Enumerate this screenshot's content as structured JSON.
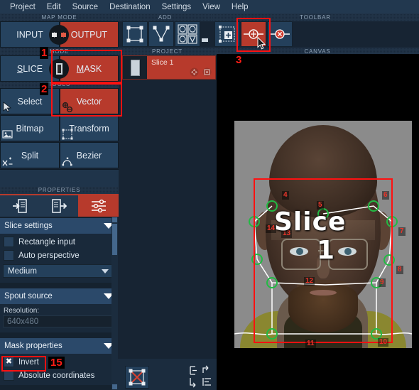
{
  "menubar": {
    "items": [
      {
        "label": "Project"
      },
      {
        "label": "Edit"
      },
      {
        "label": "Source"
      },
      {
        "label": "Destination"
      },
      {
        "label": "Settings"
      },
      {
        "label": "View"
      },
      {
        "label": "Help"
      }
    ]
  },
  "sections": {
    "map_mode": "MAP MODE",
    "add": "ADD",
    "toolbar": "TOOLBAR",
    "mode": "MODE",
    "project": "PROJECT",
    "canvas": "CANVAS",
    "tools": "TOOLS",
    "properties": "PROPERTIES"
  },
  "map_mode": {
    "input": "INPUT",
    "output": "OUTPUT",
    "active": "OUTPUT"
  },
  "mode": {
    "slice": "SLICE",
    "mask": "MASK",
    "active": "MASK"
  },
  "tools": {
    "select": "Select",
    "vector": "Vector",
    "bitmap": "Bitmap",
    "transform": "Transform",
    "split": "Split",
    "bezier": "Bezier",
    "active": "Vector"
  },
  "add_buttons": [
    {
      "name": "add-rectangle-icon"
    },
    {
      "name": "add-triangle-icon"
    },
    {
      "name": "add-grid-icon"
    }
  ],
  "toolbar_buttons": [
    {
      "name": "add-point-frame-icon"
    },
    {
      "name": "add-point-icon",
      "active": true
    },
    {
      "name": "remove-point-icon",
      "active": false
    }
  ],
  "project": {
    "item_label": "Slice 1",
    "icons": [
      "move-icon",
      "target-icon"
    ]
  },
  "properties": {
    "tabs": [
      {
        "name": "input-properties-icon",
        "active": false
      },
      {
        "name": "output-properties-icon",
        "active": false
      },
      {
        "name": "settings-sliders-icon",
        "active": true
      }
    ],
    "groups": [
      {
        "title": "Slice settings",
        "expanded": true,
        "checkboxes": [
          {
            "label": "Rectangle input",
            "checked": false
          },
          {
            "label": "Auto perspective",
            "checked": false
          }
        ],
        "combo": {
          "value": "Medium"
        }
      },
      {
        "title": "Spout source",
        "expanded": true,
        "field_label": "Resolution:",
        "field_value": "640x480"
      },
      {
        "title": "Mask properties",
        "expanded": true,
        "checkboxes": [
          {
            "label": "Invert",
            "checked": true
          },
          {
            "label": "Absolute coordinates",
            "checked": false
          }
        ]
      }
    ]
  },
  "bottom_bar": {
    "buttons": [
      {
        "name": "delete-shape-icon"
      },
      {
        "name": "align-distribute-icon"
      }
    ]
  },
  "canvas": {
    "slice_title_line1": "Slice",
    "slice_title_line2": "1",
    "vertex_labels": [
      "4",
      "5",
      "6",
      "7",
      "8",
      "9",
      "10",
      "11",
      "12",
      "13",
      "14"
    ],
    "bounding_box_color": "#ff1111",
    "vertex_handle_color": "#22bb44",
    "outline_color": "#ffffff"
  },
  "annotations": [
    {
      "number": "1",
      "target": "mask-mode-button"
    },
    {
      "number": "2",
      "target": "vector-tool-button"
    },
    {
      "number": "3",
      "target": "add-point-toolbar-button"
    },
    {
      "number": "15",
      "target": "invert-checkbox"
    }
  ],
  "colors": {
    "accent_red": "#b73a2c",
    "panel_blue": "#26435f",
    "background": "#172433",
    "highlight_red": "#ff1111",
    "marker_red": "#ff1d16"
  }
}
